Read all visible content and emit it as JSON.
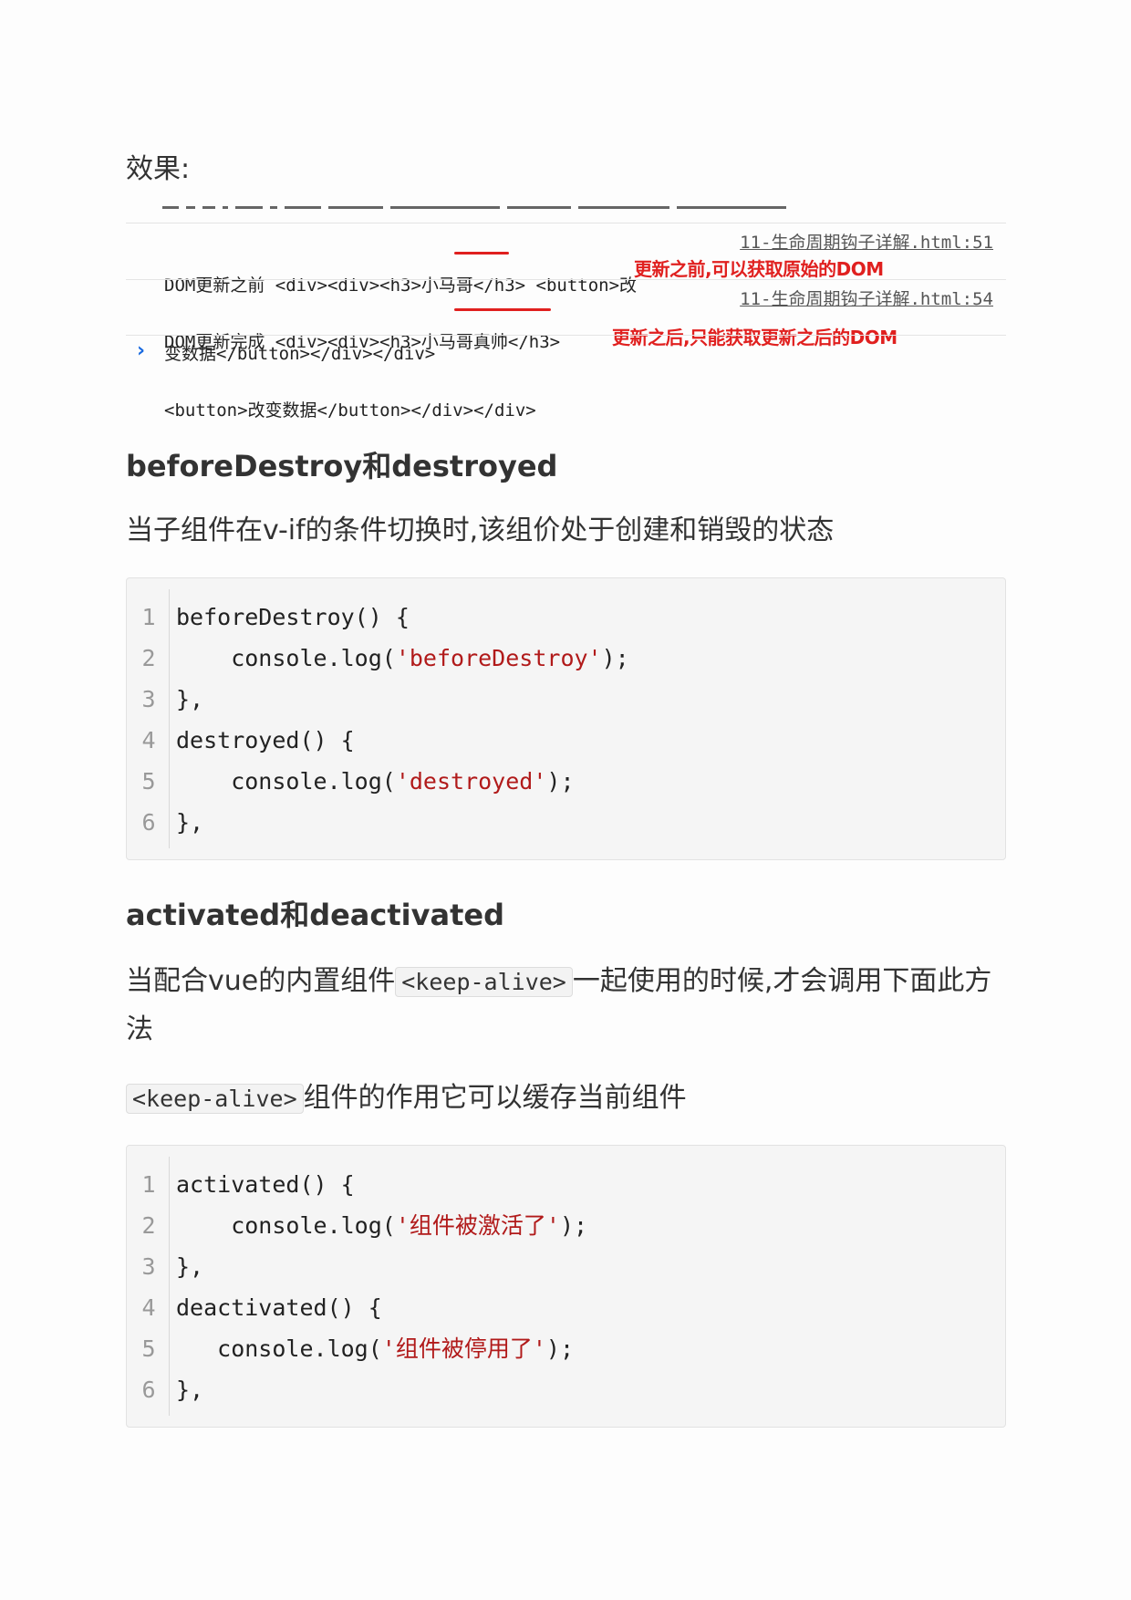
{
  "effect_label": "效果:",
  "console": {
    "row1": {
      "line1": "DOM更新之前 <div><div><h3>小马哥</h3> <button>改",
      "line2": "变数据</button></div></div>",
      "source": "11-生命周期钩子详解.html:51",
      "annotation": "更新之前,可以获取原始的DOM"
    },
    "row2": {
      "line1": "DOM更新完成 <div><div><h3>小马哥真帅</h3>",
      "line2": "<button>改变数据</button></div></div>",
      "source": "11-生命周期钩子详解.html:54",
      "annotation": "更新之后,只能获取更新之后的DOM"
    },
    "prompt": "›",
    "annotation_color": "#e0201f"
  },
  "section1": {
    "heading": "beforeDestroy和destroyed",
    "description": "当子组件在v-if的条件切换时,该组价处于创建和销毁的状态",
    "code": [
      {
        "n": "1",
        "pre": "beforeDestroy() {",
        "str": "",
        "post": ""
      },
      {
        "n": "2",
        "pre": "    console.log(",
        "str": "'beforeDestroy'",
        "post": ");"
      },
      {
        "n": "3",
        "pre": "},",
        "str": "",
        "post": ""
      },
      {
        "n": "4",
        "pre": "destroyed() {",
        "str": "",
        "post": ""
      },
      {
        "n": "5",
        "pre": "    console.log(",
        "str": "'destroyed'",
        "post": ");"
      },
      {
        "n": "6",
        "pre": "},",
        "str": "",
        "post": ""
      }
    ]
  },
  "section2": {
    "heading": "activated和deactivated",
    "desc_before": "当配合vue的内置组件",
    "desc_code": "<keep-alive>",
    "desc_after": "一起使用的时候,才会调用下面此方法",
    "note_code": "<keep-alive>",
    "note_text": "组件的作用它可以缓存当前组件",
    "code": [
      {
        "n": "1",
        "pre": "activated() {",
        "str": "",
        "post": ""
      },
      {
        "n": "2",
        "pre": "    console.log(",
        "str": "'组件被激活了'",
        "post": ");"
      },
      {
        "n": "3",
        "pre": "},",
        "str": "",
        "post": ""
      },
      {
        "n": "4",
        "pre": "deactivated() {",
        "str": "",
        "post": ""
      },
      {
        "n": "5",
        "pre": "   console.log(",
        "str": "'组件被停用了'",
        "post": ");"
      },
      {
        "n": "6",
        "pre": "},",
        "str": "",
        "post": ""
      }
    ]
  },
  "colors": {
    "string": "#b11a1a",
    "link_prompt": "#1a6ae0"
  }
}
